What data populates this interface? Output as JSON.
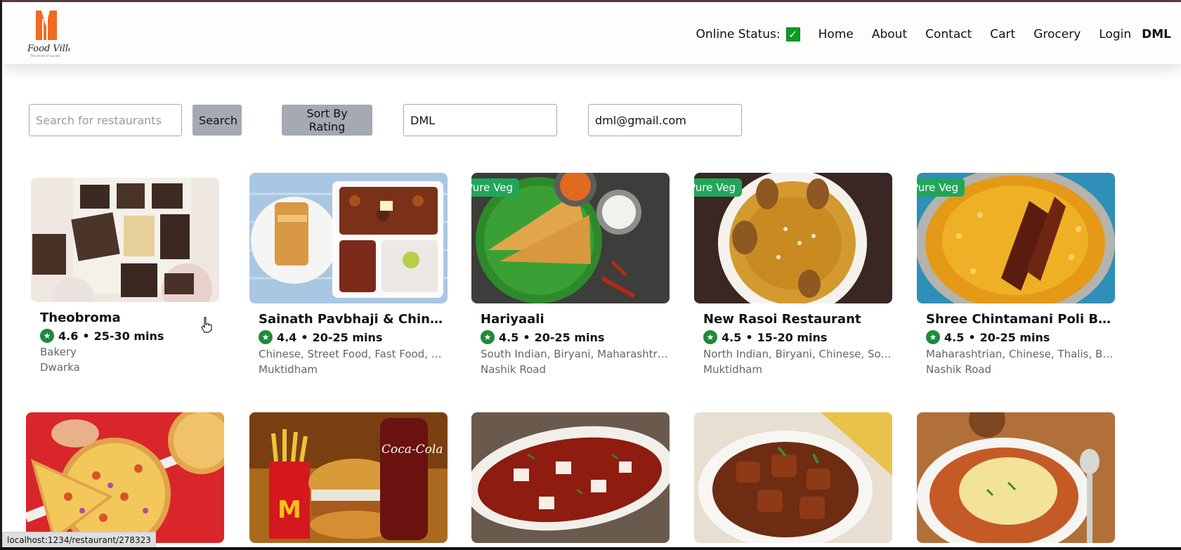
{
  "logo": {
    "text": "Food Villa",
    "tagline": "The secret of success"
  },
  "nav": {
    "status_label": "Online Status:",
    "status_check": "✓",
    "items": [
      "Home",
      "About",
      "Contact",
      "Cart",
      "Grocery",
      "Login"
    ],
    "user": "DML"
  },
  "controls": {
    "search_placeholder": "Search for restaurants",
    "search_button": "Search",
    "sort_button": "Sort By Rating",
    "name_value": "DML",
    "email_value": "dml@gmail.com"
  },
  "restaurants": [
    {
      "name": "Theobroma",
      "rating": "4.6",
      "time": "25-30 mins",
      "cuisines": "Bakery",
      "area": "Dwarka",
      "badge": ""
    },
    {
      "name": "Sainath Pavbhaji & Chines...",
      "rating": "4.4",
      "time": "20-25 mins",
      "cuisines": "Chinese, Street Food, Fast Food, S...",
      "area": "Muktidham",
      "badge": ""
    },
    {
      "name": "Hariyaali",
      "rating": "4.5",
      "time": "20-25 mins",
      "cuisines": "South Indian, Biryani, Maharashtria...",
      "area": "Nashik Road",
      "badge": "Pure Veg"
    },
    {
      "name": "New Rasoi Restaurant",
      "rating": "4.5",
      "time": "15-20 mins",
      "cuisines": "North Indian, Biryani, Chinese, Sou...",
      "area": "Muktidham",
      "badge": "Pure Veg"
    },
    {
      "name": "Shree Chintamani Poli Bha...",
      "rating": "4.5",
      "time": "20-25 mins",
      "cuisines": "Maharashtrian, Chinese, Thalis, Bir...",
      "area": "Nashik Road",
      "badge": "Pure Veg"
    }
  ],
  "rating_separator": "•",
  "status_url": "localhost:1234/restaurant/278323"
}
